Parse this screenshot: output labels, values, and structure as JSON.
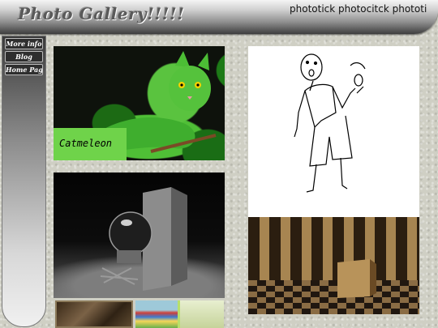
{
  "header": {
    "title": "Photo Gallery!!!!!",
    "tagline": "phototick photocitck phototi"
  },
  "sidebar": {
    "items": [
      {
        "label": "More info"
      },
      {
        "label": "Blog"
      },
      {
        "label": "Home Page"
      }
    ]
  },
  "gallery": {
    "photos": [
      {
        "caption": "Catmeleon",
        "subject": "cat-chameleon"
      },
      {
        "subject": "stick-figure-drawing"
      },
      {
        "subject": "3d-lightbulb-render"
      },
      {
        "subject": "3d-room-render"
      },
      {
        "subject": "painting-thumbnail"
      },
      {
        "subject": "group-photo-thumbnail"
      },
      {
        "subject": "green-thumbnail"
      }
    ]
  },
  "colors": {
    "caption_bg": "#6fd34a",
    "nav_bg": "#2e2e2e",
    "page_bg": "#cfcfc4"
  }
}
